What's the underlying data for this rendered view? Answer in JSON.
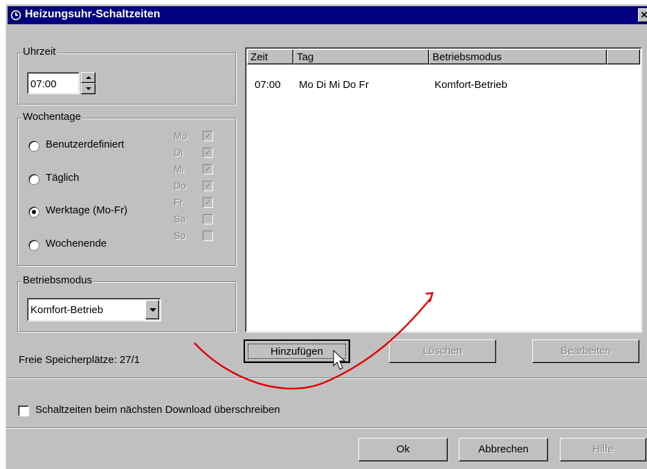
{
  "window": {
    "title": "Heizungsuhr-Schaltzeiten",
    "close_glyph": "✕",
    "title_icon": "clock-icon"
  },
  "uhrzeit": {
    "group_label": "Uhrzeit",
    "value": "07:00"
  },
  "wochentage": {
    "group_label": "Wochentage",
    "options": [
      {
        "label": "Benutzerdefiniert",
        "selected": false
      },
      {
        "label": "Täglich",
        "selected": false
      },
      {
        "label": "Werktage (Mo-Fr)",
        "selected": true
      },
      {
        "label": "Wochenende",
        "selected": false
      }
    ],
    "days": [
      {
        "label": "Mo",
        "checked": true
      },
      {
        "label": "Di",
        "checked": true
      },
      {
        "label": "Mi",
        "checked": true
      },
      {
        "label": "Do",
        "checked": true
      },
      {
        "label": "Fr",
        "checked": true
      },
      {
        "label": "Sa",
        "checked": false
      },
      {
        "label": "So",
        "checked": false
      }
    ]
  },
  "betriebsmodus": {
    "group_label": "Betriebsmodus",
    "selected": "Komfort-Betrieb"
  },
  "memory": {
    "label": "Freie Speicherplätze: 27/1"
  },
  "schedule": {
    "columns": [
      "Zeit",
      "Tag",
      "Betriebsmodus"
    ],
    "rows": [
      {
        "zeit": "07:00",
        "tag": "Mo Di Mi Do Fr",
        "modus": "Komfort-Betrieb"
      }
    ]
  },
  "actions": {
    "add": "Hinzufügen",
    "delete": "Löschen",
    "edit": "Bearbeiten"
  },
  "overwrite": {
    "label": "Schaltzeiten beim nächsten Download überschreiben",
    "checked": false
  },
  "dialog_buttons": {
    "ok": "Ok",
    "cancel": "Abbrechen",
    "help": "Hilfe"
  },
  "colors": {
    "face": "#c0c0c0",
    "titlebar": "#000080",
    "annotation_arrow": "#e00000"
  }
}
